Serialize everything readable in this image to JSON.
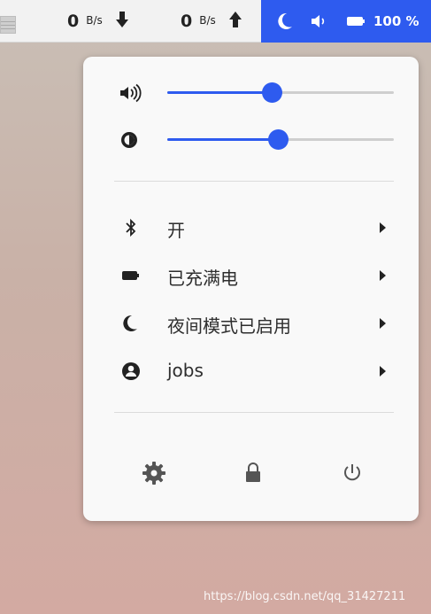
{
  "topbar": {
    "download": {
      "value": "0",
      "unit": "B/s",
      "icon": "arrow-down-icon"
    },
    "upload": {
      "value": "0",
      "unit": "B/s",
      "icon": "arrow-up-icon"
    },
    "tray": {
      "night_icon": "moon-icon",
      "volume_icon": "speaker-icon",
      "battery_icon": "battery-icon",
      "battery_percent": "100 %",
      "accent_color": "#2e5bef"
    }
  },
  "menu": {
    "volume": {
      "icon": "speaker-icon",
      "level": 0.46
    },
    "brightness": {
      "icon": "brightness-icon",
      "level": 0.49
    },
    "items": [
      {
        "icon": "bluetooth-icon",
        "label": "开"
      },
      {
        "icon": "battery-icon",
        "label": "已充满电"
      },
      {
        "icon": "moon-icon",
        "label": "夜间模式已启用"
      },
      {
        "icon": "user-icon",
        "label": "jobs"
      }
    ],
    "buttons": [
      {
        "icon": "gear-icon",
        "name": "settings"
      },
      {
        "icon": "lock-icon",
        "name": "lock"
      },
      {
        "icon": "power-icon",
        "name": "power"
      }
    ]
  },
  "watermark": "https://blog.csdn.net/qq_31427211"
}
